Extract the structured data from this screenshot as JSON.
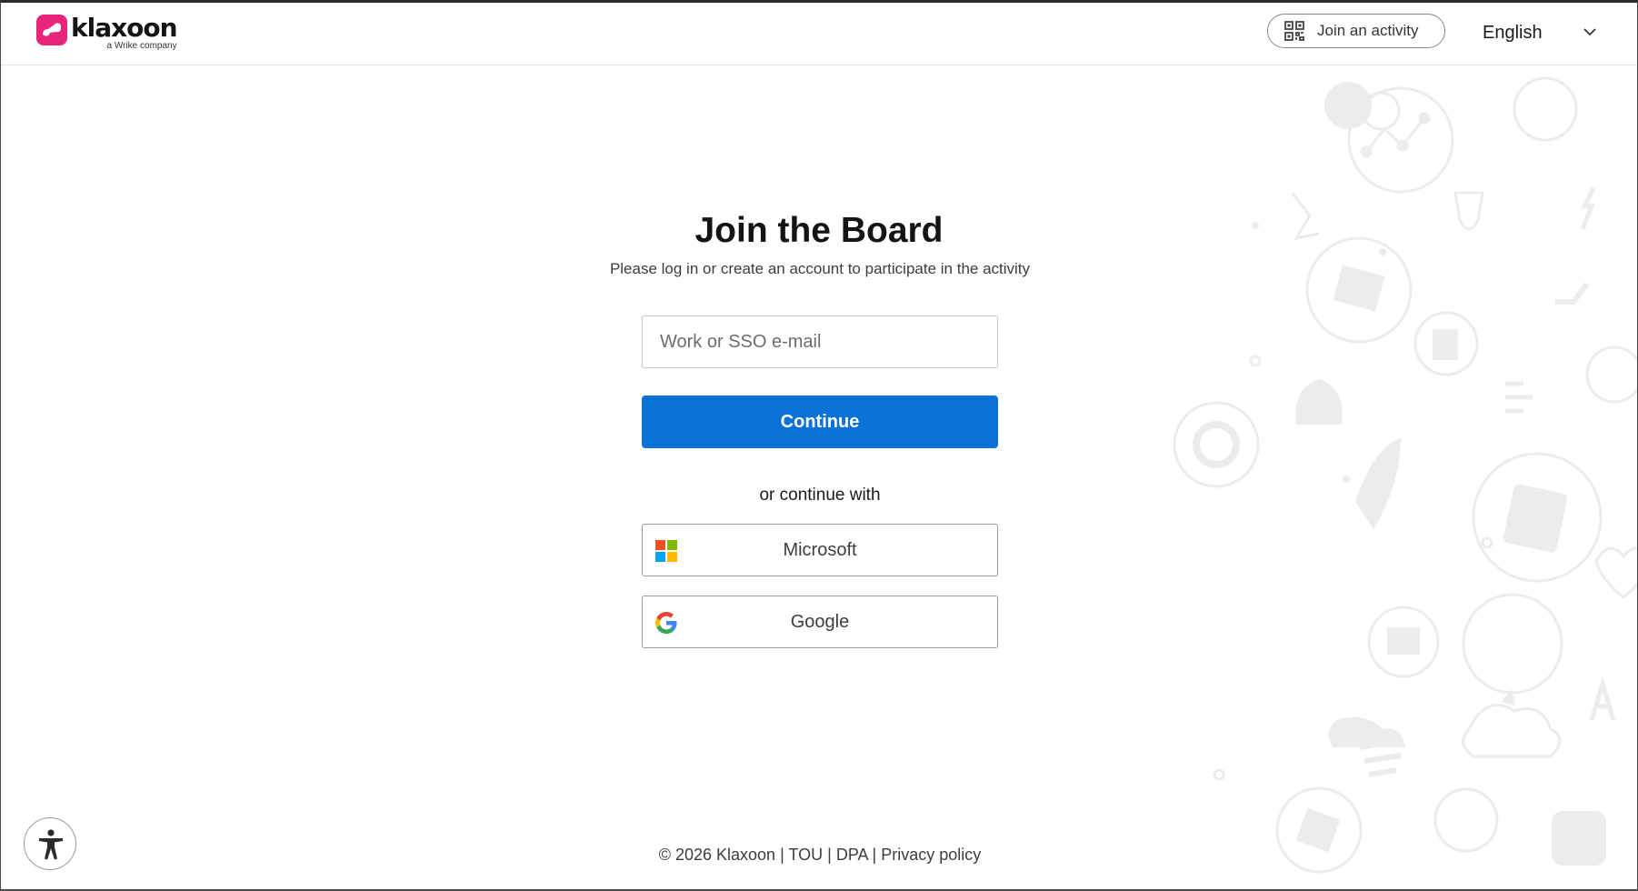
{
  "header": {
    "logo_word": "klaxoon",
    "logo_sub": "a Wrike company",
    "join_activity_label": "Join an activity",
    "language_label": "English"
  },
  "main": {
    "title": "Join the Board",
    "subtitle": "Please log in or create an account to participate in the activity",
    "email_placeholder": "Work or SSO e-mail",
    "email_value": "",
    "continue_label": "Continue",
    "or_text": "or continue with",
    "microsoft_label": "Microsoft",
    "google_label": "Google"
  },
  "footer": {
    "copyright": "© 2026 Klaxoon",
    "sep": "|",
    "tou": "TOU",
    "dpa": "DPA",
    "privacy": "Privacy policy"
  },
  "icons": {
    "logo": "klaxoon-logo-icon",
    "qr": "qr-code-icon",
    "chevron": "chevron-down-icon",
    "microsoft": "microsoft-logo-icon",
    "google": "google-logo-icon",
    "accessibility": "accessibility-icon"
  },
  "colors": {
    "brand_pink": "#e8247d",
    "primary_blue": "#0a72d6",
    "deco_gray": "#eeeeee"
  }
}
